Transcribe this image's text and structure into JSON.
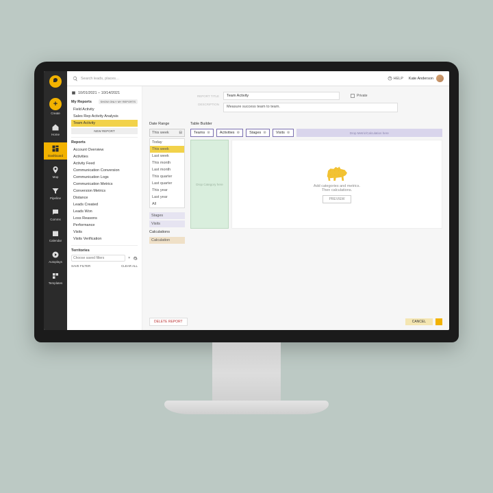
{
  "rail": {
    "create": "Create",
    "items": [
      {
        "label": "Home"
      },
      {
        "label": "Dashboard"
      },
      {
        "label": "Map"
      },
      {
        "label": "Pipeline"
      },
      {
        "label": "Comms"
      },
      {
        "label": "Calendar"
      },
      {
        "label": "Autoplays"
      },
      {
        "label": "Templates"
      }
    ]
  },
  "topbar": {
    "search_placeholder": "Search leads, places…",
    "help": "HELP",
    "user": "Kate Anderson"
  },
  "side": {
    "daterange": "10/01/2021 – 10/14/2021",
    "my_reports": "My Reports",
    "show_only": "SHOW ONLY MY REPORTS",
    "my_list": [
      "Field Activity",
      "Sales Rep Activity Analysis",
      "Team Activity"
    ],
    "new_report": "NEW REPORT",
    "reports_hdr": "Reports",
    "reports": [
      "Account Overview",
      "Activities",
      "Activity Feed",
      "Communication Conversion",
      "Communication Logs",
      "Communication Metrics",
      "Conversion Metrics",
      "Distance",
      "Leads Created",
      "Leads Won",
      "Loss Reasons",
      "Performance",
      "Visits",
      "Visits Verification"
    ],
    "territories": "Territories",
    "filter_placeholder": "Choose saved filters",
    "save_filter": "SAVE FILTER",
    "clear_all": "CLEAR ALL"
  },
  "form": {
    "report_title_lbl": "REPORT TITLE",
    "report_title": "Team Activity",
    "private": "Private",
    "desc_lbl": "DESCRIPTION",
    "desc": "Measure success team to team."
  },
  "date": {
    "hdr": "Date Range",
    "current": "This week",
    "options": [
      "Today",
      "This week",
      "Last week",
      "This month",
      "Last month",
      "This quarter",
      "Last quarter",
      "This year",
      "Last year",
      "All"
    ]
  },
  "chips": {
    "stages": "Stages",
    "visits": "Visits",
    "calc_hdr": "Calculations",
    "calc": "Calculation"
  },
  "table": {
    "hdr": "Table Builder",
    "pills": [
      "Teams",
      "Activities",
      "Stages",
      "Visits"
    ],
    "drop_metric": "Drop Metric/Calculation here",
    "drop_cat": "Drop Category here",
    "hint": "Add categories and metrics.\nThen calculations.",
    "preview": "PREVIEW"
  },
  "footer": {
    "delete": "DELETE REPORT",
    "cancel": "CANCEL"
  }
}
